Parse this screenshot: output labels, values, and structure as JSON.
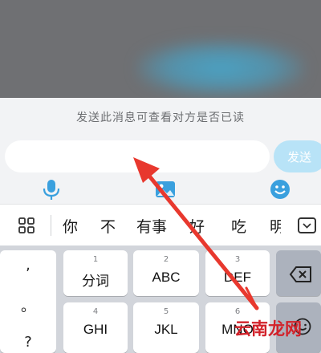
{
  "composer": {
    "hint": "发送此消息可查看对方是否已读",
    "input_value": "",
    "send_label": "发送",
    "tools": [
      "microphone-icon",
      "image-icon",
      "emoji-icon"
    ]
  },
  "candidates": [
    "你",
    "不",
    "有事",
    "好",
    "吃",
    "明"
  ],
  "keyboard": {
    "left_column": [
      ",",
      "。",
      "?"
    ],
    "keys": [
      {
        "digit": "1",
        "label": "分词"
      },
      {
        "digit": "2",
        "label": "ABC"
      },
      {
        "digit": "3",
        "label": "DEF"
      },
      {
        "digit": "4",
        "label": "GHI"
      },
      {
        "digit": "5",
        "label": "JKL"
      },
      {
        "digit": "6",
        "label": "MNO"
      }
    ]
  },
  "watermark": "云南龙网",
  "colors": {
    "send_button": "#b8e3f7",
    "arrow": "#e8382e",
    "accent_icon": "#3aa0de"
  }
}
